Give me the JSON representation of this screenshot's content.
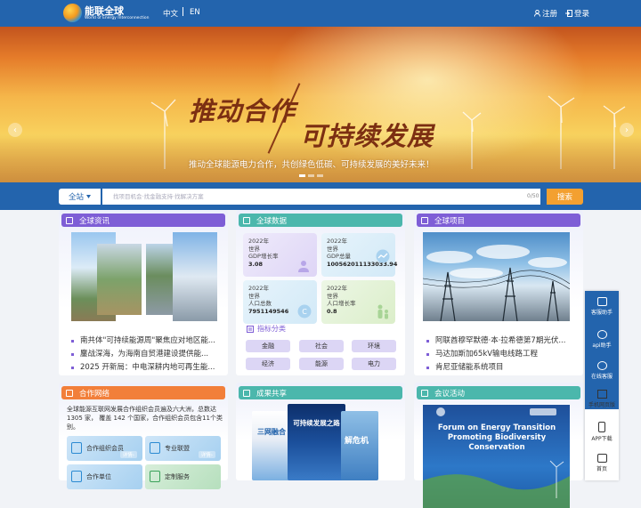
{
  "header": {
    "logo_cn": "能联全球",
    "logo_en": "World of Energy Interconnection",
    "lang_zh": "中文",
    "lang_en": "EN",
    "register": "注册",
    "login": "登录"
  },
  "banner": {
    "slogan_a": "推动合作",
    "slogan_b": "可持续发展",
    "subtitle": "推动全球能源电力合作，共创绿色低碳、可持续发展的美好未来！",
    "prev": "‹",
    "next": "›"
  },
  "search": {
    "scope": "全站",
    "placeholder": "找项目机会·找金融支持·找解决方案",
    "count": "0/50",
    "button": "搜索"
  },
  "news": {
    "title": "全球资讯",
    "items": [
      "南共体\"可持续能源周\"聚焦应对地区能...",
      "鏖战深海，为海南自贸港建设提供能...",
      "2025 开新局：中电深耕内地可再生能..."
    ]
  },
  "data": {
    "title": "全球数据",
    "stats": [
      {
        "year": "2022年",
        "scope": "世界",
        "metric": "GDP增长率",
        "value": "3.08"
      },
      {
        "year": "2022年",
        "scope": "世界",
        "metric": "GDP总量",
        "value": "100562011133033.94"
      },
      {
        "year": "2022年",
        "scope": "世界",
        "metric": "人口总数",
        "value": "7951149546"
      },
      {
        "year": "2022年",
        "scope": "世界",
        "metric": "人口增长率",
        "value": "0.8"
      }
    ],
    "category_title": "指标分类",
    "tags": [
      "金融",
      "社会",
      "环境",
      "经济",
      "能源",
      "电力"
    ]
  },
  "projects": {
    "title": "全球项目",
    "items": [
      "阿联酋穆罕默德·本·拉希德第7期光伏...",
      "马达加斯加65kV输电线路工程",
      "肯尼亚储能系统项目"
    ]
  },
  "partners": {
    "title": "合作网络",
    "text": "全球能源互联网发展合作组织会员遍及六大洲，总数达 1305 家， 覆盖 142 个国家，合作组织会员包含11个类别。",
    "boxes": [
      {
        "label": "合作组织会员",
        "more": "详情›"
      },
      {
        "label": "专业联盟",
        "more": "详情›"
      },
      {
        "label": "合作单位",
        "more": ""
      },
      {
        "label": "定制服务",
        "more": ""
      }
    ]
  },
  "results": {
    "title": "成果共享",
    "book1_title": "可持续发展之路",
    "book2_title": "解危机",
    "book3_title": "三网融合"
  },
  "meetings": {
    "title": "会议活动",
    "poster_title": "Forum on Energy Transition Promoting Biodiversity Conservation"
  },
  "sidebar": {
    "items": [
      "客服助手",
      "api助手",
      "在线客服",
      "手机网页版",
      "APP下载",
      "首页"
    ]
  },
  "colors": {
    "header_blue": "#2364ad",
    "search_button": "#f3a030",
    "purple": "#7e5ed6",
    "teal": "#4bb7ac",
    "orange": "#f27f3a"
  }
}
